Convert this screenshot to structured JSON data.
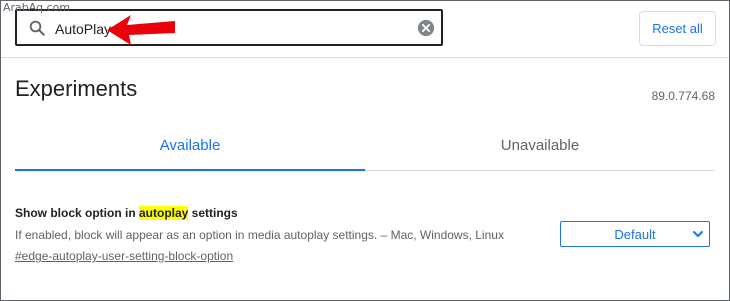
{
  "watermark": "ArabAq.com",
  "search": {
    "value": "AutoPlay",
    "icon": "search-icon",
    "clear_icon": "clear-icon"
  },
  "toolbar": {
    "reset_label": "Reset all"
  },
  "page": {
    "title": "Experiments",
    "version": "89.0.774.68"
  },
  "tabs": [
    {
      "label": "Available",
      "active": true
    },
    {
      "label": "Unavailable",
      "active": false
    }
  ],
  "experiment": {
    "title_before": "Show block option in ",
    "title_highlight": "autoplay",
    "title_after": " settings",
    "description": "If enabled, block will appear as an option in media autoplay settings. – Mac, Windows, Linux",
    "link": "#edge-autoplay-user-setting-block-option",
    "select_value": "Default"
  },
  "colors": {
    "accent": "#1a73e8",
    "highlight": "#ffff00",
    "annotation": "#e8000b"
  }
}
